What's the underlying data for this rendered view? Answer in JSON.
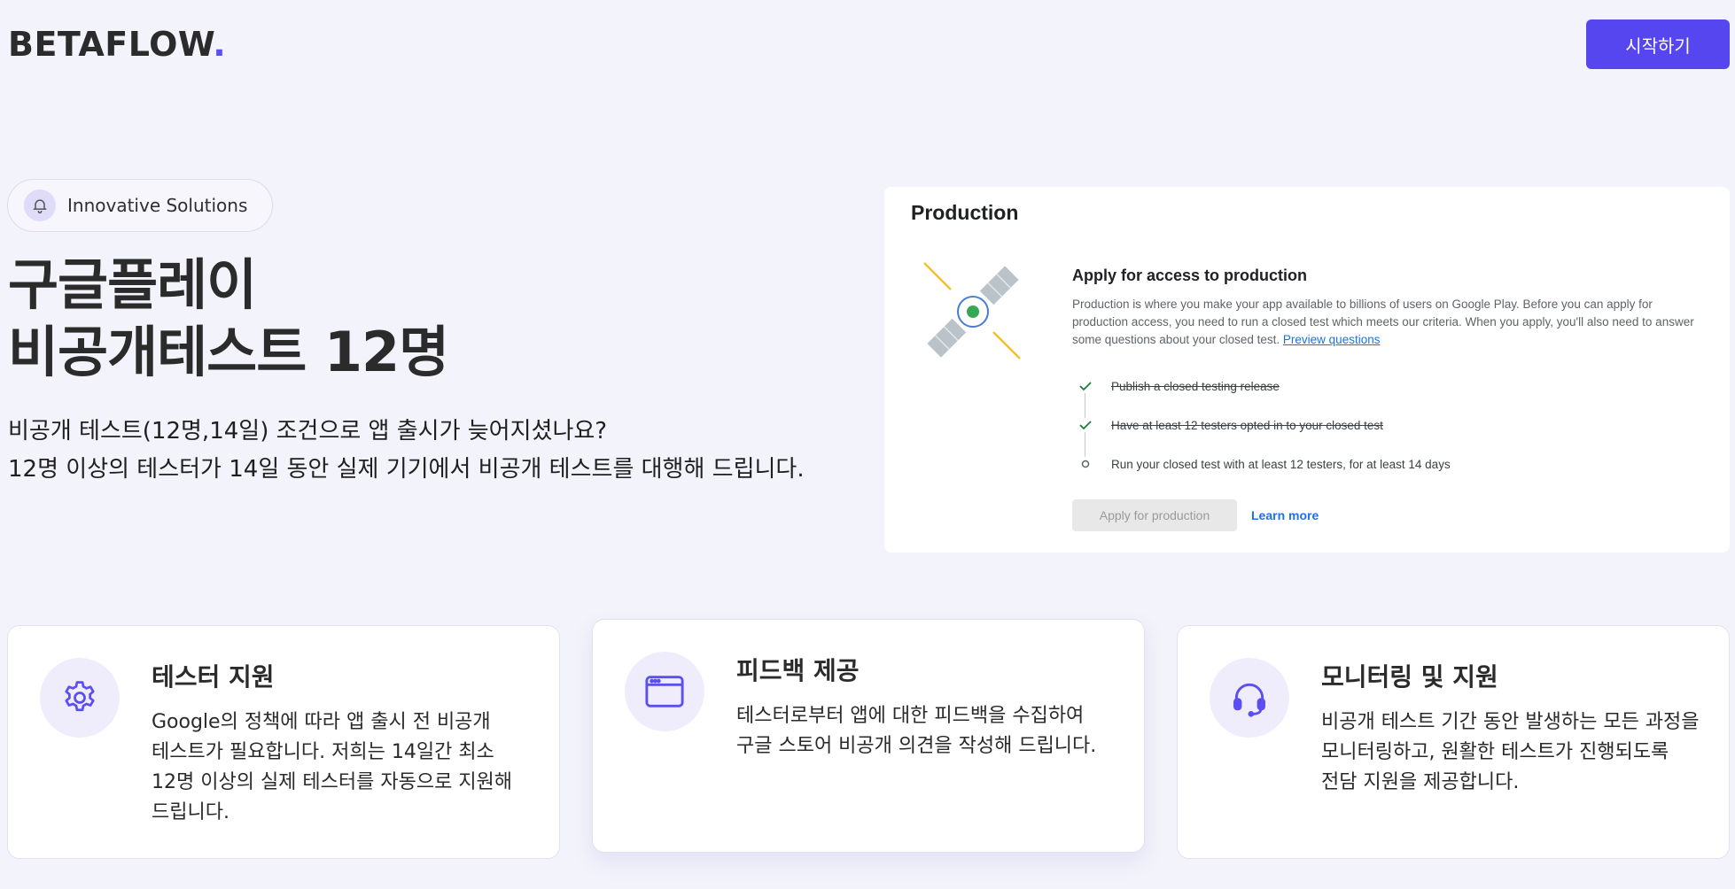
{
  "header": {
    "brand_text": "BETAFLOW",
    "brand_dot": ".",
    "cta_label": "시작하기"
  },
  "hero": {
    "pill_label": "Innovative Solutions",
    "title_line1": "구글플레이",
    "title_line2": "비공개테스트 12명",
    "subtitle_line1": "비공개 테스트(12명,14일) 조건으로 앱 출시가 늦어지셨나요?",
    "subtitle_line2": "12명 이상의 테스터가 14일 동안 실제 기기에서 비공개 테스트를 대행해 드립니다."
  },
  "production": {
    "title": "Production",
    "heading": "Apply for access to production",
    "description": "Production is where you make your app available to billions of users on Google Play. Before you can apply for production access, you need to run a closed test which meets our criteria. When you apply, you'll also need to answer some questions about your closed test.",
    "preview_link": "Preview questions",
    "checklist": [
      {
        "label": "Publish a closed testing release",
        "done": true
      },
      {
        "label": "Have at least 12 testers opted in to your closed test",
        "done": true
      },
      {
        "label": "Run your closed test with at least 12 testers, for at least 14 days",
        "done": false
      }
    ],
    "apply_label": "Apply for production",
    "learn_more_label": "Learn more"
  },
  "features": [
    {
      "icon": "gear-icon",
      "title": "테스터 지원",
      "description": "Google의 정책에 따라 앱 출시 전 비공개 테스트가 필요합니다. 저희는 14일간 최소 12명 이상의 실제 테스터를 자동으로 지원해 드립니다."
    },
    {
      "icon": "browser-window-icon",
      "title": "피드백 제공",
      "description": "테스터로부터 앱에 대한 피드백을 수집하여 구글 스토어 비공개 의견을 작성해 드립니다."
    },
    {
      "icon": "headset-icon",
      "title": "모니터링 및 지원",
      "description": "비공개 테스트 기간 동안 발생하는 모든 과정을 모니터링하고, 원활한 테스트가 진행되도록 전담 지원을 제공합니다."
    }
  ],
  "colors": {
    "accent": "#5546ef",
    "background": "#f3f3fb",
    "icon_bg": "#efedfb",
    "link": "#1a73e8",
    "check_green": "#188038"
  }
}
